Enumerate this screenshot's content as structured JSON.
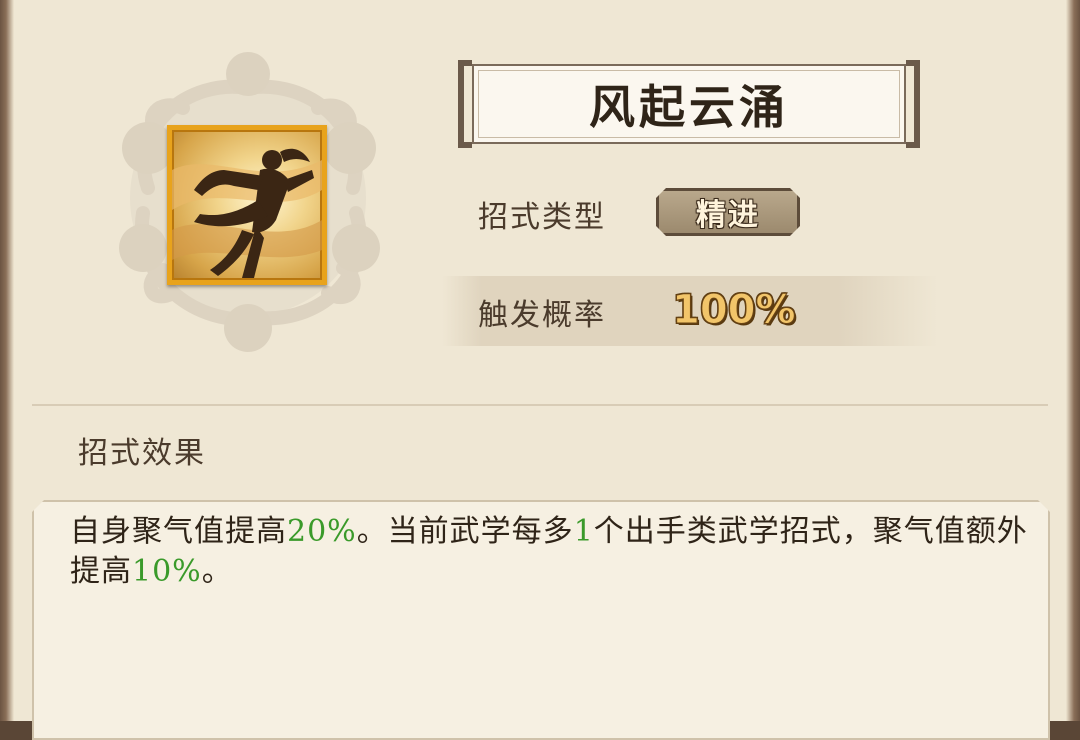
{
  "skill": {
    "name": "风起云涌",
    "icon": "martial-artist-kick-icon",
    "type_label": "招式类型",
    "type_value": "精进",
    "trigger_label": "触发概率",
    "trigger_value": "100%"
  },
  "effect": {
    "heading": "招式效果",
    "parts": [
      {
        "text": "自身聚气值提高",
        "highlight": false
      },
      {
        "text": "20%",
        "highlight": true
      },
      {
        "text": "。当前武学每多",
        "highlight": false
      },
      {
        "text": "1",
        "highlight": true
      },
      {
        "text": "个出手类武学招式，聚气值额外提高",
        "highlight": false
      },
      {
        "text": "10%",
        "highlight": true
      },
      {
        "text": "。",
        "highlight": false
      }
    ]
  },
  "colors": {
    "highlight": "#3a9a2a",
    "icon_border": "#e8a31c",
    "rate_value": "#f2c56a"
  }
}
